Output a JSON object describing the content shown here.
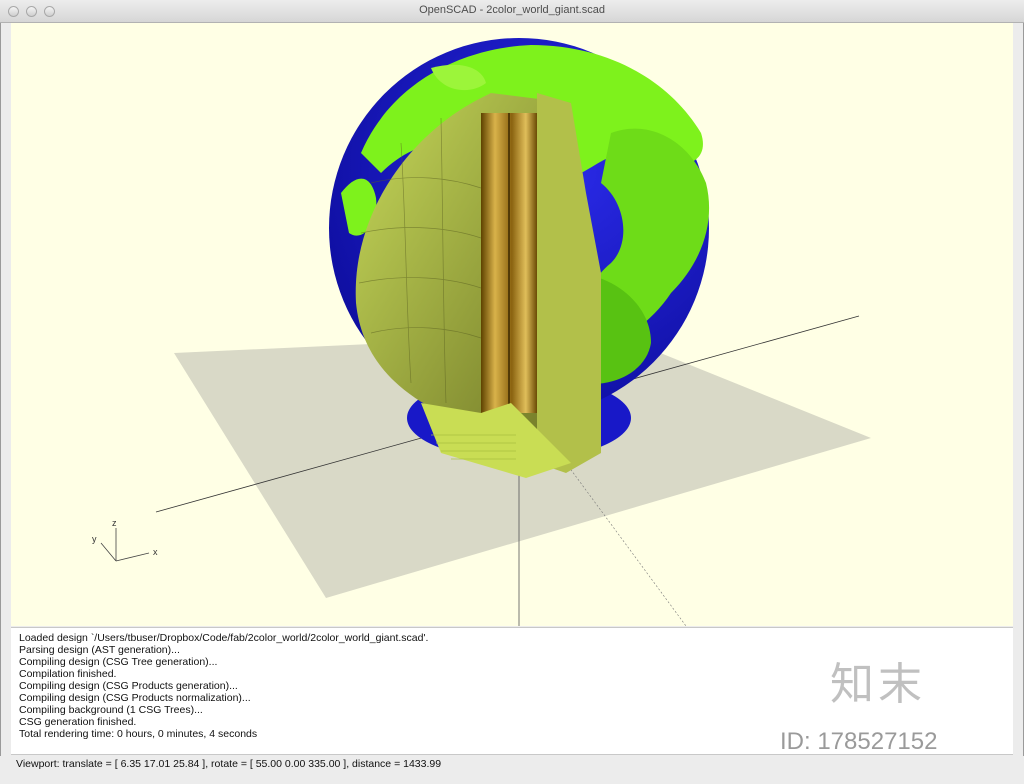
{
  "window": {
    "title": "OpenSCAD - 2color_world_giant.scad"
  },
  "viewport": {
    "axis_labels": {
      "x": "x",
      "y": "y",
      "z": "z"
    },
    "colors": {
      "background": "#ffffe5",
      "land": "#7ef21c",
      "ocean": "#1b1bd1",
      "cutaway": "#a8b73c",
      "core": "#b58a1e",
      "plane": "#d9d9c7"
    }
  },
  "console": {
    "lines": [
      "Loaded design `/Users/tbuser/Dropbox/Code/fab/2color_world/2color_world_giant.scad'.",
      "Parsing design (AST generation)...",
      "Compiling design (CSG Tree generation)...",
      "Compilation finished.",
      "Compiling design (CSG Products generation)...",
      "Compiling design (CSG Products normalization)...",
      "Compiling background (1 CSG Trees)...",
      "CSG generation finished.",
      "Total rendering time: 0 hours, 0 minutes, 4 seconds"
    ]
  },
  "statusbar": {
    "text": "Viewport: translate = [ 6.35 17.01 25.84 ], rotate = [ 55.00 0.00 335.00 ], distance = 1433.99"
  },
  "watermark": {
    "brand": "知末",
    "id": "ID: 178527152"
  }
}
